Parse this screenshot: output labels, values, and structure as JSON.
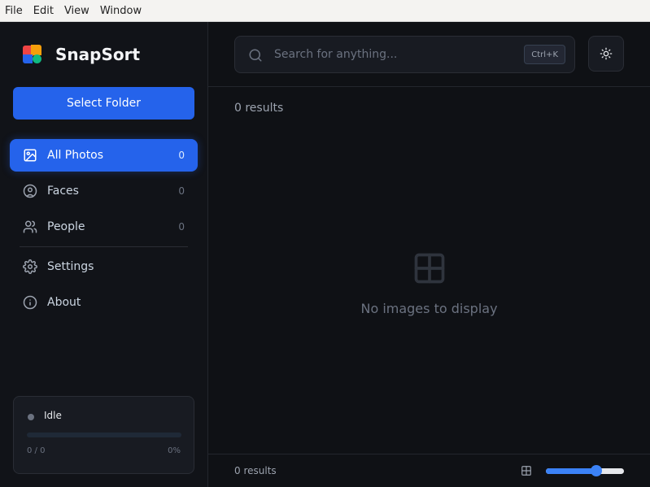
{
  "menubar": [
    "File",
    "Edit",
    "View",
    "Window"
  ],
  "app": {
    "name": "SnapSort"
  },
  "sidebar": {
    "select_folder": "Select Folder",
    "items": [
      {
        "label": "All Photos",
        "count": "0",
        "icon": "image-icon",
        "active": true
      },
      {
        "label": "Faces",
        "count": "0",
        "icon": "face-icon"
      },
      {
        "label": "People",
        "count": "0",
        "icon": "people-icon"
      },
      {
        "label": "Settings",
        "icon": "gear-icon"
      },
      {
        "label": "About",
        "icon": "info-icon"
      }
    ]
  },
  "status": {
    "label": "Idle",
    "count": "0 / 0",
    "percent": "0%",
    "progress": 0
  },
  "search": {
    "placeholder": "Search for anything...",
    "shortcut": "Ctrl+K"
  },
  "main": {
    "results_count": "0 results",
    "empty_message": "No images to display"
  },
  "footer": {
    "results_count": "0 results",
    "zoom_level": 0.65
  },
  "colors": {
    "accent": "#2563eb",
    "background": "#0f1115",
    "sidebar": "#111318"
  }
}
